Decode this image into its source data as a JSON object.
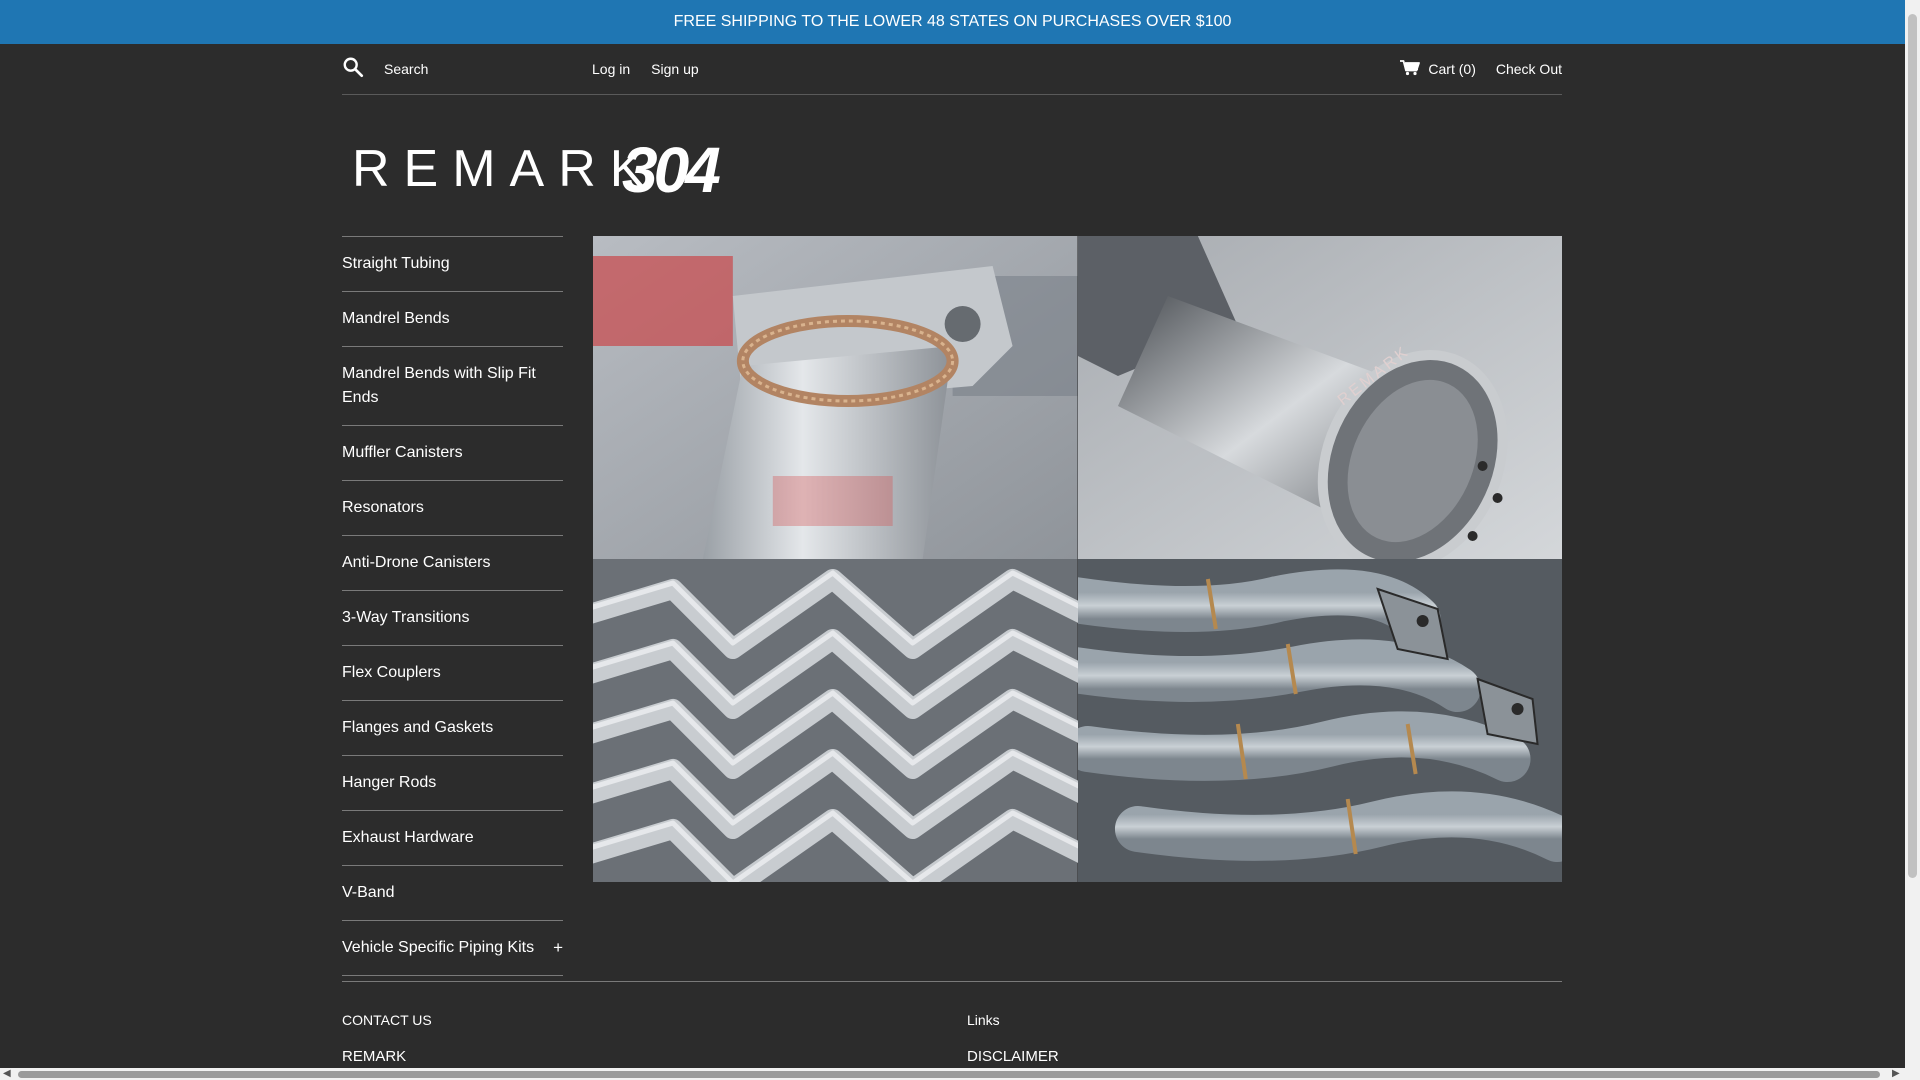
{
  "announcement": "FREE SHIPPING TO THE LOWER 48 STATES ON PURCHASES OVER $100",
  "header": {
    "search_placeholder": "Search",
    "login": "Log in",
    "signup": "Sign up",
    "cart": "Cart (0)",
    "checkout": "Check Out"
  },
  "logo": {
    "text_left": "REMARK",
    "text_right": "304"
  },
  "sidebar": {
    "items": [
      {
        "label": "Straight Tubing"
      },
      {
        "label": "Mandrel Bends"
      },
      {
        "label": "Mandrel Bends with Slip Fit Ends"
      },
      {
        "label": "Muffler Canisters"
      },
      {
        "label": "Resonators"
      },
      {
        "label": "Anti-Drone Canisters"
      },
      {
        "label": "3-Way Transitions"
      },
      {
        "label": "Flex Couplers"
      },
      {
        "label": "Flanges and Gaskets"
      },
      {
        "label": "Hanger Rods"
      },
      {
        "label": "Exhaust Hardware"
      },
      {
        "label": "V-Band"
      },
      {
        "label": "Vehicle Specific Piping Kits",
        "expand": "+"
      }
    ]
  },
  "hero": {
    "tip_brand": "REMARK"
  },
  "footer": {
    "contact_heading": "CONTACT US",
    "contact_first": "REMARK",
    "links_heading": "Links",
    "links_first": "DISCLAIMER"
  },
  "colors": {
    "background": "#2c2c2c",
    "announcement_bar": "#1f76b3",
    "text": "#ffffff",
    "divider": "#7a7a7a"
  }
}
